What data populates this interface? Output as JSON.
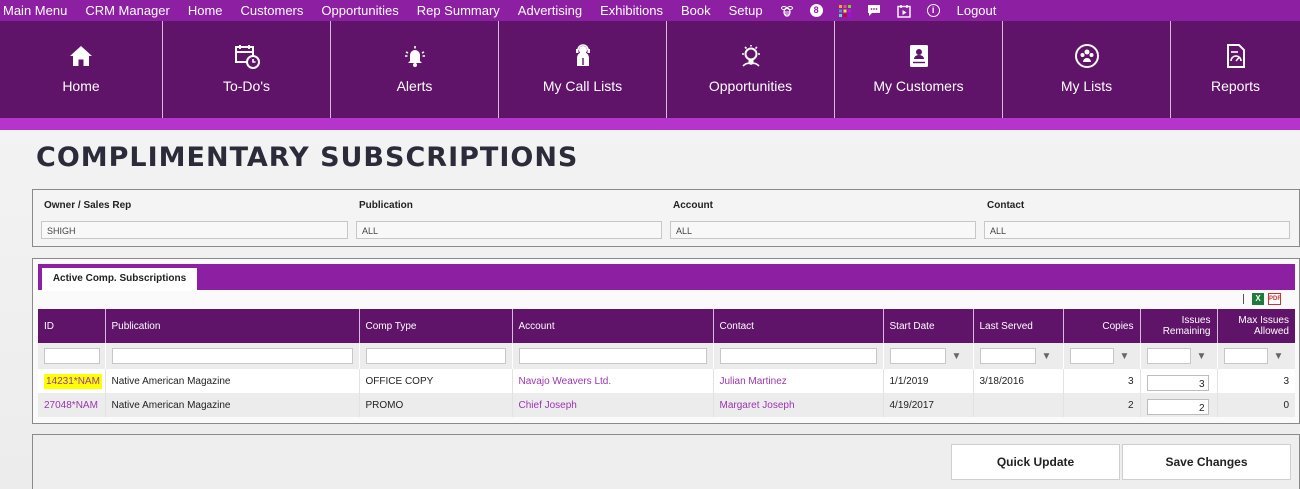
{
  "top_menu": {
    "items": [
      "Main Menu",
      "CRM Manager",
      "Home",
      "Customers",
      "Opportunities",
      "Rep Summary",
      "Advertising",
      "Exhibitions",
      "Book",
      "Setup"
    ],
    "icons": [
      "bee-icon",
      "badge-8-icon",
      "apps-grid-icon",
      "chat-icon",
      "calendar-play-icon",
      "info-icon"
    ],
    "badge_label": "8",
    "info_label": "i",
    "logout": "Logout"
  },
  "nav": {
    "tiles": [
      {
        "label": "Home",
        "icon": "home-icon"
      },
      {
        "label": "To-Do's",
        "icon": "calendar-clock-icon"
      },
      {
        "label": "Alerts",
        "icon": "bell-alert-icon"
      },
      {
        "label": "My Call Lists",
        "icon": "call-list-icon"
      },
      {
        "label": "Opportunities",
        "icon": "lightbulb-icon"
      },
      {
        "label": "My Customers",
        "icon": "customer-card-icon"
      },
      {
        "label": "My Lists",
        "icon": "people-circle-icon"
      },
      {
        "label": "Reports",
        "icon": "report-doc-icon"
      }
    ]
  },
  "page": {
    "title": "COMPLIMENTARY SUBSCRIPTIONS"
  },
  "filters": {
    "owner_label": "Owner / Sales Rep",
    "owner_value": "SHIGH",
    "publication_label": "Publication",
    "publication_value": "ALL",
    "account_label": "Account",
    "account_value": "ALL",
    "contact_label": "Contact",
    "contact_value": "ALL"
  },
  "grid": {
    "tab_label": "Active Comp. Subscriptions",
    "export_excel": "X",
    "export_pdf": "PDF",
    "columns": {
      "id": "ID",
      "publication": "Publication",
      "comp_type": "Comp Type",
      "account": "Account",
      "contact": "Contact",
      "start_date": "Start Date",
      "last_served": "Last Served",
      "copies": "Copies",
      "issues_remaining": "Issues Remaining",
      "max_issues": "Max Issues Allowed"
    },
    "rows": [
      {
        "id": "14231*NAM",
        "publication": "Native American Magazine",
        "comp_type": "OFFICE COPY",
        "account": "Navajo Weavers Ltd.",
        "contact": "Julian Martinez",
        "start_date": "1/1/2019",
        "last_served": "3/18/2016",
        "copies": "3",
        "issues_remaining": "3",
        "max_issues": "3"
      },
      {
        "id": "27048*NAM",
        "publication": "Native American Magazine",
        "comp_type": "PROMO",
        "account": "Chief Joseph",
        "contact": "Margaret Joseph",
        "start_date": "4/19/2017",
        "last_served": "",
        "copies": "2",
        "issues_remaining": "2",
        "max_issues": "0"
      }
    ]
  },
  "actions": {
    "quick_update": "Quick Update",
    "save_changes": "Save Changes"
  },
  "colors": {
    "menu_bar": "#8c1fa2",
    "nav_bar": "#5f1369",
    "accent": "#b535cc",
    "link": "#9b35b0",
    "highlight": "#ffff00"
  }
}
